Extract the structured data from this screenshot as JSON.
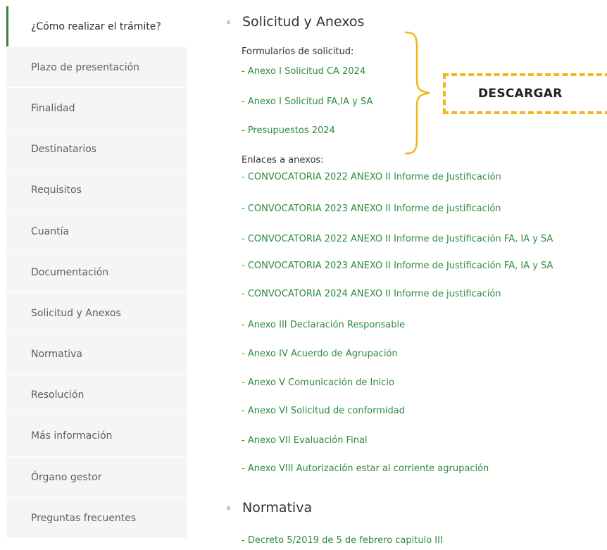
{
  "sidebar": {
    "items": [
      {
        "label": "¿Cómo realizar el trámite?",
        "active": true
      },
      {
        "label": "Plazo de presentación"
      },
      {
        "label": "Finalidad"
      },
      {
        "label": "Destinatarios"
      },
      {
        "label": "Requisitos"
      },
      {
        "label": "Cuantía"
      },
      {
        "label": "Documentación"
      },
      {
        "label": "Solicitud y Anexos"
      },
      {
        "label": "Normativa"
      },
      {
        "label": "Resolución"
      },
      {
        "label": "Más información"
      },
      {
        "label": "Órgano gestor"
      },
      {
        "label": "Preguntas frecuentes"
      }
    ]
  },
  "solicitud": {
    "heading": "Solicitud y Anexos",
    "formularios_label": "Formularios de solicitud:",
    "formularios": [
      "- Anexo I Solicitud CA 2024",
      "- Anexo I Solicitud FA,IA y SA",
      "- Presupuestos 2024"
    ],
    "enlaces_label": "Enlaces a anexos:",
    "enlaces": [
      "- CONVOCATORIA 2022 ANEXO II Informe de Justificación",
      "- CONVOCATORIA 2023 ANEXO II Informe de justificación",
      "- CONVOCATORIA 2022 ANEXO II Informe de Justificación FA, IA y SA",
      "- CONVOCATORIA 2023 ANEXO II Informe de Justificación FA, IA y SA",
      "- CONVOCATORIA 2024 ANEXO II Informe de justificación",
      "- Anexo III Declaración Responsable",
      "- Anexo IV Acuerdo de Agrupación",
      "- Anexo V Comunicación de Inicio",
      "- Anexo VI Solicitud de conformidad",
      "- Anexo VII Evaluación Final",
      "- Anexo VIII Autorización estar al corriente agrupación"
    ]
  },
  "normativa": {
    "heading": "Normativa",
    "links": [
      "- Decreto 5/2019 de 5 de febrero capitulo III"
    ]
  },
  "annotation": {
    "download_label": "DESCARGAR"
  },
  "colors": {
    "link": "#2e8b3f",
    "active_bar": "#3a7d44",
    "sidebar_bg": "#f5f5f5",
    "annotation": "#f0b81e"
  }
}
